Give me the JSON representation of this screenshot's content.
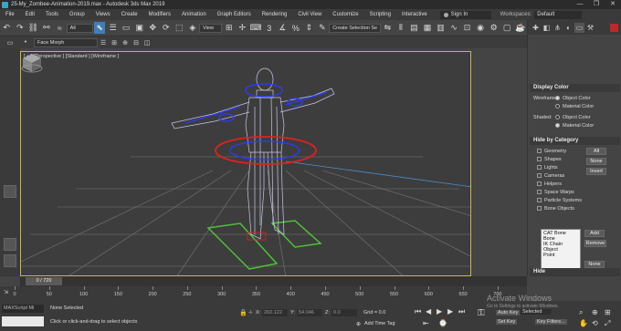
{
  "window": {
    "title": "25-My_Zombee-Animation-2019.max - Autodesk 3ds Max 2019",
    "controls": [
      "—",
      "❐",
      "✕"
    ]
  },
  "menu": {
    "items": [
      "File",
      "Edit",
      "Tools",
      "Group",
      "Views",
      "Create",
      "Modifiers",
      "Animation",
      "Graph Editors",
      "Rendering",
      "Civil View",
      "Customize",
      "Scripting",
      "Interactive"
    ],
    "sign_in": "Sign In",
    "workspaces_label": "Workspaces:",
    "workspaces_value": "Default"
  },
  "toolbar": {
    "selection_filter": "All",
    "ref_coord": "View",
    "named_selection": "Create Selection Se",
    "face_morph": "Face Morph"
  },
  "viewport": {
    "label": "[ + ] [Perspective ] [Standard ] [Wireframe ]"
  },
  "command_panel": {
    "display_color": {
      "header": "Display Color",
      "wireframe_label": "Wireframe:",
      "wireframe_options": [
        "Object Color",
        "Material Color"
      ],
      "shaded_label": "Shaded:",
      "shaded_options": [
        "Object Color",
        "Material Color"
      ]
    },
    "hide_by_category": {
      "header": "Hide by Category",
      "items": [
        "Geometry",
        "Shapes",
        "Lights",
        "Cameras",
        "Helpers",
        "Space Warps",
        "Particle Systems",
        "Bone Objects"
      ],
      "buttons": [
        "All",
        "None",
        "Invert"
      ],
      "list": [
        "CAT Bone",
        "Bone",
        "IK Chain Object",
        "Point"
      ],
      "list_buttons": [
        "Add",
        "Remove",
        "None"
      ]
    },
    "hide_header": "Hide"
  },
  "timeline": {
    "current": "0 / 720",
    "ticks": [
      "0",
      "50",
      "100",
      "150",
      "200",
      "250",
      "300",
      "350",
      "400",
      "450",
      "500",
      "550",
      "600",
      "650",
      "700"
    ]
  },
  "status": {
    "maxscript": "MAXScript Mi",
    "selection": "None Selected",
    "prompt": "Click or click-and-drag to select objects",
    "x_label": "X:",
    "x_value": "260.122",
    "y_label": "Y:",
    "y_value": "54.046",
    "z_label": "Z:",
    "z_value": "0.0",
    "grid": "Grid = 0.0",
    "add_time_tag": "Add Time Tag",
    "auto_key": "Auto Key",
    "selected": "Selected",
    "set_key": "Set Key",
    "key_filters": "Key Filters..."
  },
  "watermark": {
    "title": "Activate Windows",
    "subtitle": "Go to Settings to activate Windows."
  }
}
